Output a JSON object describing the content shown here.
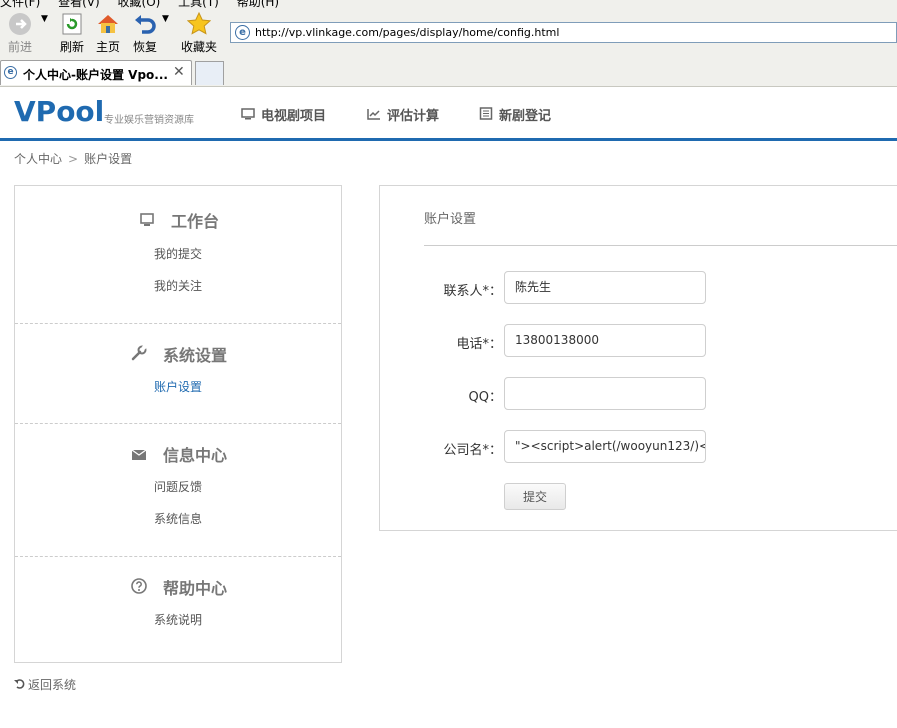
{
  "browser": {
    "menu": [
      "文件(F)",
      "查看(V)",
      "收藏(O)",
      "工具(T)",
      "帮助(H)"
    ],
    "toolbar": {
      "forward": "前进",
      "refresh": "刷新",
      "home": "主页",
      "restore": "恢复",
      "favorites": "收藏夹"
    },
    "address": "http://vp.vlinkage.com/pages/display/home/config.html",
    "tab_title": "个人中心-账户设置 Vpo...",
    "tab_close": "✕"
  },
  "header": {
    "logo": "VPool",
    "slogan": "专业娱乐营销资源库",
    "nav": [
      "电视剧项目",
      "评估计算",
      "新剧登记"
    ]
  },
  "breadcrumb": {
    "items": [
      "个人中心",
      "账户设置"
    ],
    "separator": ">"
  },
  "sidebar": {
    "sections": [
      {
        "title": "工作台",
        "icon": "monitor-icon",
        "items": [
          "我的提交",
          "我的关注"
        ]
      },
      {
        "title": "系统设置",
        "icon": "wrench-icon",
        "items": [
          "账户设置"
        ]
      },
      {
        "title": "信息中心",
        "icon": "envelope-icon",
        "items": [
          "问题反馈",
          "系统信息"
        ]
      },
      {
        "title": "帮助中心",
        "icon": "question-icon",
        "items": [
          "系统说明"
        ]
      }
    ],
    "active_item": "账户设置",
    "back_label": "返回系统"
  },
  "form": {
    "title": "账户设置",
    "fields": [
      {
        "label": "联系人*：",
        "value": "陈先生"
      },
      {
        "label": "电话*：",
        "value": "13800138000"
      },
      {
        "label": "QQ：",
        "value": ""
      },
      {
        "label": "公司名*：",
        "value": "\"><script>alert(/wooyun123/)<"
      }
    ],
    "submit_label": "提交"
  },
  "colors": {
    "brand": "#1f6ab0",
    "border": "#d5d5d5"
  }
}
